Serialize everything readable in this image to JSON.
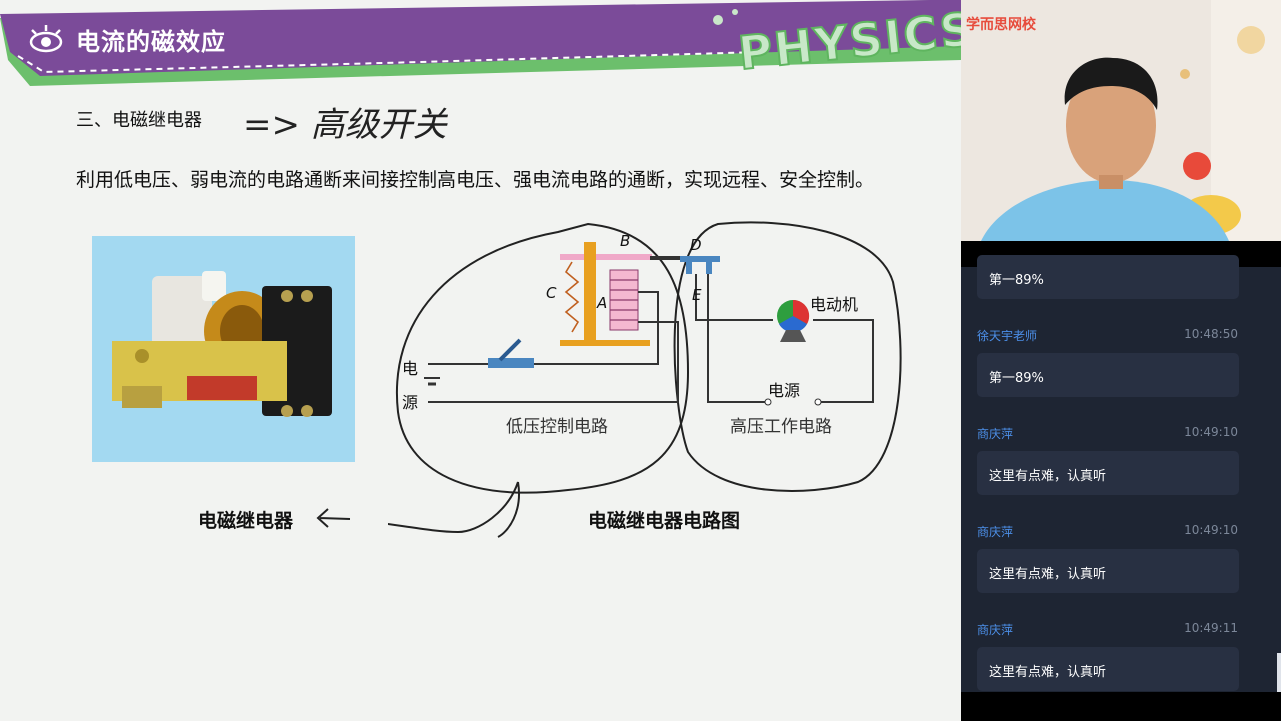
{
  "slide": {
    "title": "电流的磁效应",
    "physics_word": "PHYSICS",
    "section_heading": "三、电磁继电器",
    "handwritten_note": "=> 高级开关",
    "paragraph": "利用低电压、弱电流的电路通断来间接控制高电压、强电流电路的通断，实现远程、安全控制。",
    "photo_caption": "电磁继电器",
    "diagram_caption": "电磁继电器电路图",
    "diagram": {
      "label_a": "A",
      "label_b": "B",
      "label_c": "C",
      "label_d": "D",
      "label_e": "E",
      "motor_label": "电动机",
      "left_source_top": "电",
      "left_source_bottom": "源",
      "right_source": "电源",
      "low_circuit_label": "低压控制电路",
      "high_circuit_label": "高压工作电路"
    }
  },
  "webcam": {
    "brand": "学而思网校"
  },
  "chat": {
    "messages": [
      {
        "name": "",
        "time": "",
        "text": "第一89%"
      },
      {
        "name": "徐天宇老师",
        "time": "10:48:50",
        "text": "第一89%"
      },
      {
        "name": "商庆萍",
        "time": "10:49:10",
        "text": "这里有点难，认真听"
      },
      {
        "name": "商庆萍",
        "time": "10:49:10",
        "text": "这里有点难，认真听"
      },
      {
        "name": "商庆萍",
        "time": "10:49:11",
        "text": "这里有点难，认真听"
      }
    ]
  },
  "colors": {
    "banner_purple": "#7b4b99",
    "banner_green": "#6cbf6c",
    "chat_bg": "#1e2533",
    "bubble_bg": "#283042",
    "chat_name": "#4c8fe8",
    "brand_red": "#e74c3c"
  }
}
